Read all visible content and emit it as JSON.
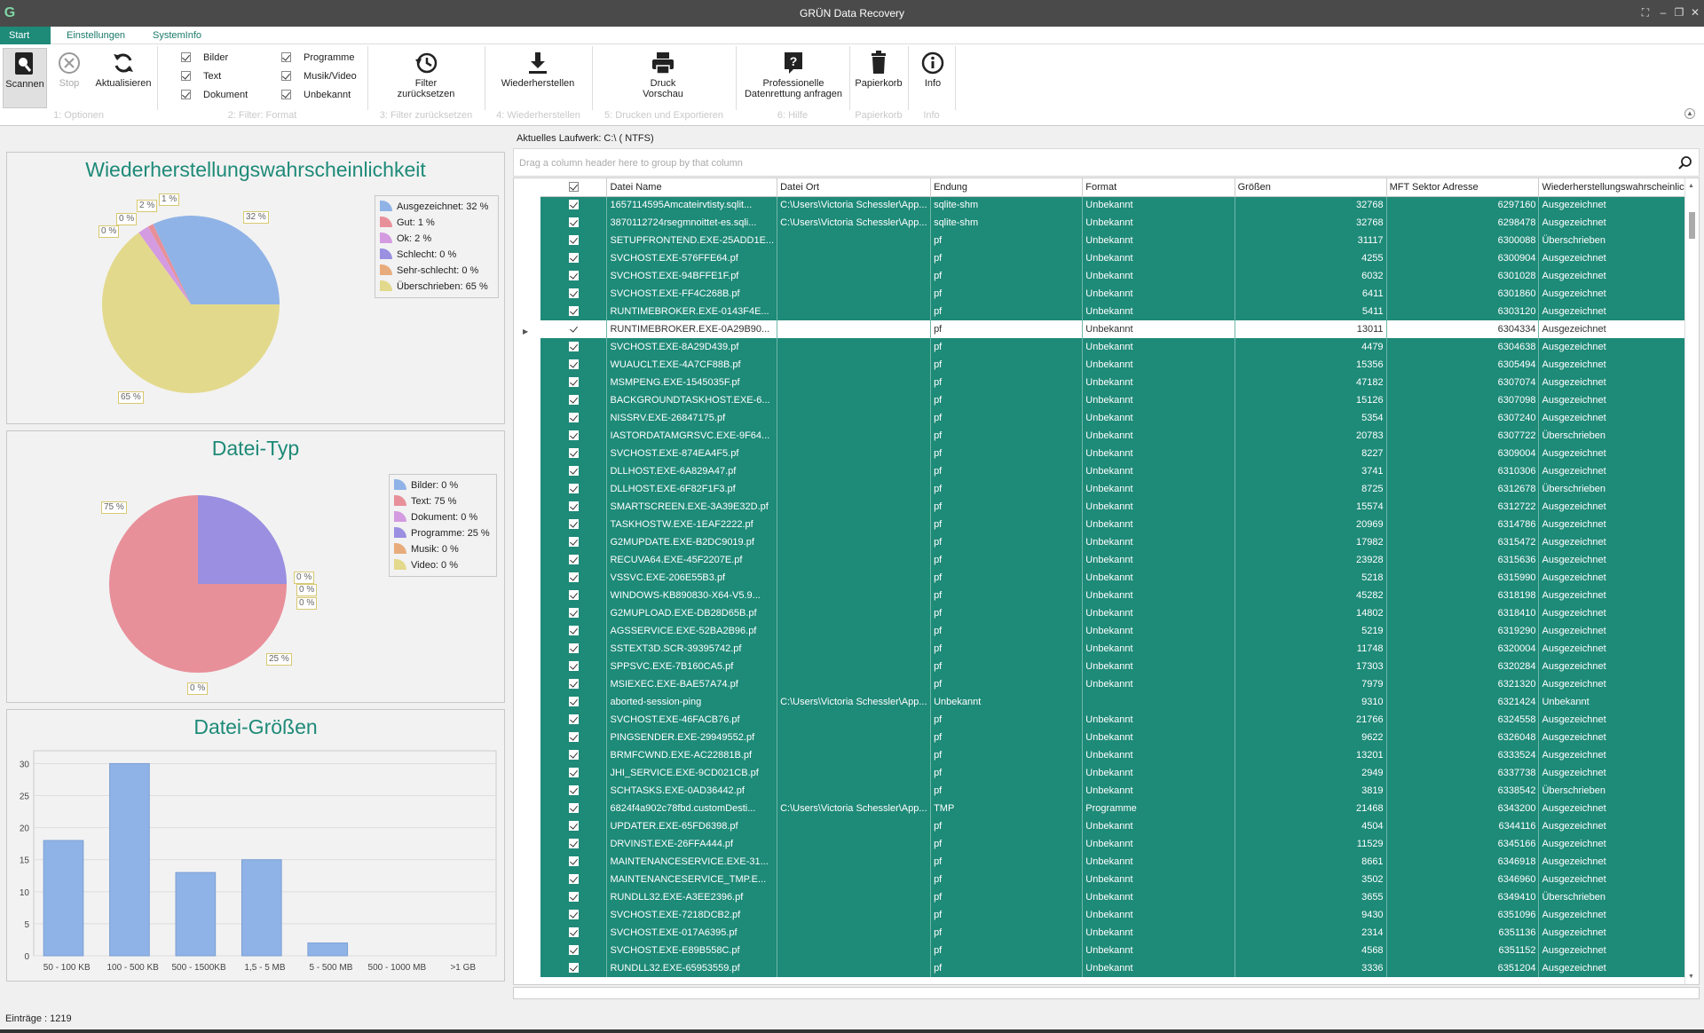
{
  "window": {
    "title": "GRÜN Data Recovery",
    "logo": "G"
  },
  "tabs": [
    {
      "label": "Start"
    },
    {
      "label": "Einstellungen"
    },
    {
      "label": "SystemInfo"
    }
  ],
  "ribbon": {
    "scan": "Scannen",
    "stop": "Stop",
    "refresh": "Aktualisieren",
    "filters": [
      {
        "label": "Bilder"
      },
      {
        "label": "Text"
      },
      {
        "label": "Dokument"
      },
      {
        "label": "Programme"
      },
      {
        "label": "Musik/Video"
      },
      {
        "label": "Unbekannt"
      }
    ],
    "reset_l1": "Filter",
    "reset_l2": "zurücksetzen",
    "restore": "Wiederherstellen",
    "print_l1": "Druck",
    "print_l2": "Vorschau",
    "pro_l1": "Professionelle",
    "pro_l2": "Datenrettung anfragen",
    "trash": "Papierkorb",
    "info": "Info",
    "groups": [
      "1: Optionen",
      "2: Filter: Format",
      "3: Filter zurücksetzen",
      "4: Wiederherstellen",
      "5: Drucken und Exportieren",
      "6: Hilfe",
      "Papierkorb",
      "Info"
    ]
  },
  "charts": {
    "prob_title": "Wiederherstellungswahrscheinlichkeit",
    "prob_legend": [
      "Ausgezeichnet: 32 %",
      "Gut: 1 %",
      "Ok: 2 %",
      "Schlecht: 0 %",
      "Sehr-schlecht: 0 %",
      "Überschrieben: 65 %"
    ],
    "prob_labels": [
      "32 %",
      "1 %",
      "2 %",
      "0 %",
      "0 %",
      "65 %"
    ],
    "type_title": "Datei-Typ",
    "type_legend": [
      "Bilder: 0 %",
      "Text: 75 %",
      "Dokument: 0 %",
      "Programme: 25 %",
      "Musik: 0 %",
      "Video: 0 %"
    ],
    "type_labels": [
      "75 %",
      "0 %",
      "0 %",
      "0 %",
      "25 %",
      "0 %"
    ],
    "size_title": "Datei-Größen"
  },
  "colors": {
    "excellent": "#8fb3e6",
    "good": "#e8909a",
    "ok": "#d49be0",
    "bad": "#9a8fe0",
    "verybad": "#e8ac7c",
    "overwritten": "#e3d98c",
    "accent": "#1e8a78"
  },
  "chart_data": [
    {
      "type": "pie",
      "title": "Wiederherstellungswahrscheinlichkeit",
      "categories": [
        "Ausgezeichnet",
        "Gut",
        "Ok",
        "Schlecht",
        "Sehr-schlecht",
        "Überschrieben"
      ],
      "values": [
        32,
        1,
        2,
        0,
        0,
        65
      ],
      "legend": "right"
    },
    {
      "type": "pie",
      "title": "Datei-Typ",
      "categories": [
        "Bilder",
        "Text",
        "Dokument",
        "Programme",
        "Musik",
        "Video"
      ],
      "values": [
        0,
        75,
        0,
        25,
        0,
        0
      ],
      "legend": "right"
    },
    {
      "type": "bar",
      "title": "Datei-Größen",
      "categories": [
        "50 - 100 KB",
        "100 - 500 KB",
        "500 - 1500KB",
        "1,5 - 5 MB",
        "5 - 500 MB",
        "500 - 1000 MB",
        ">1 GB"
      ],
      "values": [
        18,
        30,
        13,
        15,
        2,
        0,
        0
      ],
      "ylim": [
        0,
        32
      ],
      "yticks": [
        0,
        5,
        10,
        15,
        20,
        25,
        30
      ],
      "grid": true
    }
  ],
  "grid": {
    "drive": "Aktuelles Laufwerk: C:\\ ( NTFS)",
    "group_hint": "Drag a column header here to group by that column",
    "columns": [
      "Datei Name",
      "Datei Ort",
      "Endung",
      "Format",
      "Größen",
      "MFT Sektor Adresse",
      "Wiederherstellungswahrscheinlich..."
    ],
    "rows": [
      [
        "1657114595Amcateirvtisty.sqlit...",
        "C:\\Users\\Victoria Schessler\\App...",
        "sqlite-shm",
        "Unbekannt",
        "32768",
        "6297160",
        "Ausgezeichnet"
      ],
      [
        "3870112724rsegmnoittet-es.sqli...",
        "C:\\Users\\Victoria Schessler\\App...",
        "sqlite-shm",
        "Unbekannt",
        "32768",
        "6298478",
        "Ausgezeichnet"
      ],
      [
        "SETUPFRONTEND.EXE-25ADD1E...",
        "",
        "pf",
        "Unbekannt",
        "31117",
        "6300088",
        "Überschrieben"
      ],
      [
        "SVCHOST.EXE-576FFE64.pf",
        "",
        "pf",
        "Unbekannt",
        "4255",
        "6300904",
        "Ausgezeichnet"
      ],
      [
        "SVCHOST.EXE-94BFFE1F.pf",
        "",
        "pf",
        "Unbekannt",
        "6032",
        "6301028",
        "Ausgezeichnet"
      ],
      [
        "SVCHOST.EXE-FF4C268B.pf",
        "",
        "pf",
        "Unbekannt",
        "6411",
        "6301860",
        "Ausgezeichnet"
      ],
      [
        "RUNTIMEBROKER.EXE-0143F4E...",
        "",
        "pf",
        "Unbekannt",
        "5411",
        "6303120",
        "Ausgezeichnet"
      ],
      [
        "RUNTIMEBROKER.EXE-0A29B90...",
        "",
        "pf",
        "Unbekannt",
        "13011",
        "6304334",
        "Ausgezeichnet"
      ],
      [
        "SVCHOST.EXE-8A29D439.pf",
        "",
        "pf",
        "Unbekannt",
        "4479",
        "6304638",
        "Ausgezeichnet"
      ],
      [
        "WUAUCLT.EXE-4A7CF88B.pf",
        "",
        "pf",
        "Unbekannt",
        "15356",
        "6305494",
        "Ausgezeichnet"
      ],
      [
        "MSMPENG.EXE-1545035F.pf",
        "",
        "pf",
        "Unbekannt",
        "47182",
        "6307074",
        "Ausgezeichnet"
      ],
      [
        "BACKGROUNDTASKHOST.EXE-6...",
        "",
        "pf",
        "Unbekannt",
        "15126",
        "6307098",
        "Ausgezeichnet"
      ],
      [
        "NISSRV.EXE-26847175.pf",
        "",
        "pf",
        "Unbekannt",
        "5354",
        "6307240",
        "Ausgezeichnet"
      ],
      [
        "IASTORDATAMGRSVC.EXE-9F64...",
        "",
        "pf",
        "Unbekannt",
        "20783",
        "6307722",
        "Überschrieben"
      ],
      [
        "SVCHOST.EXE-874EA4F5.pf",
        "",
        "pf",
        "Unbekannt",
        "8227",
        "6309004",
        "Ausgezeichnet"
      ],
      [
        "DLLHOST.EXE-6A829A47.pf",
        "",
        "pf",
        "Unbekannt",
        "3741",
        "6310306",
        "Ausgezeichnet"
      ],
      [
        "DLLHOST.EXE-6F82F1F3.pf",
        "",
        "pf",
        "Unbekannt",
        "8725",
        "6312678",
        "Überschrieben"
      ],
      [
        "SMARTSCREEN.EXE-3A39E32D.pf",
        "",
        "pf",
        "Unbekannt",
        "15574",
        "6312722",
        "Ausgezeichnet"
      ],
      [
        "TASKHOSTW.EXE-1EAF2222.pf",
        "",
        "pf",
        "Unbekannt",
        "20969",
        "6314786",
        "Ausgezeichnet"
      ],
      [
        "G2MUPDATE.EXE-B2DC9019.pf",
        "",
        "pf",
        "Unbekannt",
        "17982",
        "6315472",
        "Ausgezeichnet"
      ],
      [
        "RECUVA64.EXE-45F2207E.pf",
        "",
        "pf",
        "Unbekannt",
        "23928",
        "6315636",
        "Ausgezeichnet"
      ],
      [
        "VSSVC.EXE-206E55B3.pf",
        "",
        "pf",
        "Unbekannt",
        "5218",
        "6315990",
        "Ausgezeichnet"
      ],
      [
        "WINDOWS-KB890830-X64-V5.9...",
        "",
        "pf",
        "Unbekannt",
        "45282",
        "6318198",
        "Ausgezeichnet"
      ],
      [
        "G2MUPLOAD.EXE-DB28D65B.pf",
        "",
        "pf",
        "Unbekannt",
        "14802",
        "6318410",
        "Ausgezeichnet"
      ],
      [
        "AGSSERVICE.EXE-52BA2B96.pf",
        "",
        "pf",
        "Unbekannt",
        "5219",
        "6319290",
        "Ausgezeichnet"
      ],
      [
        "SSTEXT3D.SCR-39395742.pf",
        "",
        "pf",
        "Unbekannt",
        "11748",
        "6320004",
        "Ausgezeichnet"
      ],
      [
        "SPPSVC.EXE-7B160CA5.pf",
        "",
        "pf",
        "Unbekannt",
        "17303",
        "6320284",
        "Ausgezeichnet"
      ],
      [
        "MSIEXEC.EXE-BAE57A74.pf",
        "",
        "pf",
        "Unbekannt",
        "7979",
        "6321320",
        "Ausgezeichnet"
      ],
      [
        "aborted-session-ping",
        "C:\\Users\\Victoria Schessler\\App...",
        "Unbekannt",
        "",
        "9310",
        "6321424",
        "Unbekannt"
      ],
      [
        "SVCHOST.EXE-46FACB76.pf",
        "",
        "pf",
        "Unbekannt",
        "21766",
        "6324558",
        "Ausgezeichnet"
      ],
      [
        "PINGSENDER.EXE-29949552.pf",
        "",
        "pf",
        "Unbekannt",
        "9622",
        "6326048",
        "Ausgezeichnet"
      ],
      [
        "BRMFCWND.EXE-AC22881B.pf",
        "",
        "pf",
        "Unbekannt",
        "13201",
        "6333524",
        "Ausgezeichnet"
      ],
      [
        "JHI_SERVICE.EXE-9CD021CB.pf",
        "",
        "pf",
        "Unbekannt",
        "2949",
        "6337738",
        "Ausgezeichnet"
      ],
      [
        "SCHTASKS.EXE-0AD36442.pf",
        "",
        "pf",
        "Unbekannt",
        "3819",
        "6338542",
        "Überschrieben"
      ],
      [
        "6824f4a902c78fbd.customDesti...",
        "C:\\Users\\Victoria Schessler\\App...",
        "TMP",
        "Programme",
        "21468",
        "6343200",
        "Ausgezeichnet"
      ],
      [
        "UPDATER.EXE-65FD6398.pf",
        "",
        "pf",
        "Unbekannt",
        "4504",
        "6344116",
        "Ausgezeichnet"
      ],
      [
        "DRVINST.EXE-26FFA444.pf",
        "",
        "pf",
        "Unbekannt",
        "11529",
        "6345166",
        "Ausgezeichnet"
      ],
      [
        "MAINTENANCESERVICE.EXE-31...",
        "",
        "pf",
        "Unbekannt",
        "8661",
        "6346918",
        "Ausgezeichnet"
      ],
      [
        "MAINTENANCESERVICE_TMP.E...",
        "",
        "pf",
        "Unbekannt",
        "3502",
        "6346960",
        "Ausgezeichnet"
      ],
      [
        "RUNDLL32.EXE-A3EE2396.pf",
        "",
        "pf",
        "Unbekannt",
        "3655",
        "6349410",
        "Überschrieben"
      ],
      [
        "SVCHOST.EXE-7218DCB2.pf",
        "",
        "pf",
        "Unbekannt",
        "9430",
        "6351096",
        "Ausgezeichnet"
      ],
      [
        "SVCHOST.EXE-017A6395.pf",
        "",
        "pf",
        "Unbekannt",
        "2314",
        "6351136",
        "Ausgezeichnet"
      ],
      [
        "SVCHOST.EXE-E89B558C.pf",
        "",
        "pf",
        "Unbekannt",
        "4568",
        "6351152",
        "Ausgezeichnet"
      ],
      [
        "RUNDLL32.EXE-65953559.pf",
        "",
        "pf",
        "Unbekannt",
        "3336",
        "6351204",
        "Ausgezeichnet"
      ]
    ]
  },
  "status": "Einträge : 1219"
}
